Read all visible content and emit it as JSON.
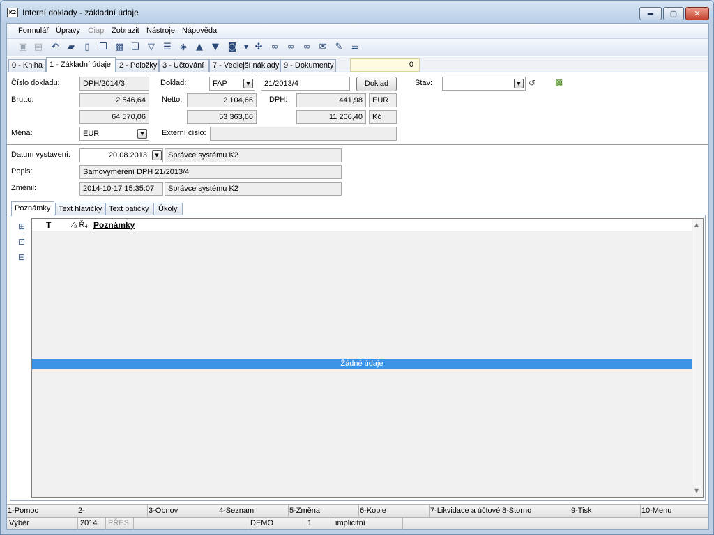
{
  "window": {
    "title": "Interní doklady - základní údaje",
    "icon_label": "K2",
    "min_label": "▬",
    "max_label": "▢",
    "close_label": "✕"
  },
  "menu": [
    {
      "label": "Formulář",
      "disabled": false
    },
    {
      "label": "Úpravy",
      "disabled": false
    },
    {
      "label": "Oiap",
      "disabled": true
    },
    {
      "label": "Zobrazit",
      "disabled": false
    },
    {
      "label": "Nástroje",
      "disabled": false
    },
    {
      "label": "Nápověda",
      "disabled": false
    }
  ],
  "toolbar": [
    {
      "name": "save-icon",
      "glyph": "▣",
      "gray": true
    },
    {
      "name": "save-as-icon",
      "glyph": "▤",
      "gray": true
    },
    {
      "name": "undo-icon",
      "glyph": "↶"
    },
    {
      "name": "open-folder-icon",
      "glyph": "▰"
    },
    {
      "name": "new-document-icon",
      "glyph": "▯"
    },
    {
      "name": "copy-icon",
      "glyph": "❐"
    },
    {
      "name": "lock-icon",
      "glyph": "▩"
    },
    {
      "name": "book-icon",
      "glyph": "❑"
    },
    {
      "name": "filter-icon",
      "glyph": "▽"
    },
    {
      "name": "filter-list-icon",
      "glyph": "☰"
    },
    {
      "name": "layers-icon",
      "glyph": "◈"
    },
    {
      "name": "arrow-up-icon",
      "glyph": "▲"
    },
    {
      "name": "arrow-down-icon",
      "glyph": "▼"
    },
    {
      "name": "camera-icon",
      "glyph": "◙"
    },
    {
      "name": "dropdown-arrow-icon",
      "glyph": "▾"
    },
    {
      "name": "plant-icon",
      "glyph": "✣"
    },
    {
      "name": "binoculars-icon",
      "glyph": "∞"
    },
    {
      "name": "binoculars-down-icon",
      "glyph": "∞"
    },
    {
      "name": "binoculars-up-icon",
      "glyph": "∞"
    },
    {
      "name": "mail-icon",
      "glyph": "✉"
    },
    {
      "name": "notepad-icon",
      "glyph": "✎"
    },
    {
      "name": "menu-lines-icon",
      "glyph": "≡"
    }
  ],
  "tabs": [
    {
      "label": "0 - Kniha",
      "active": false
    },
    {
      "label": "1 - Základní údaje",
      "active": true
    },
    {
      "label": "2 - Položky",
      "active": false
    },
    {
      "label": "3 - Účtování",
      "active": false
    },
    {
      "label": "7 - Vedlejší náklady",
      "active": false
    },
    {
      "label": "9 - Dokumenty",
      "active": false
    }
  ],
  "counter": "0",
  "form": {
    "cislo_label": "Číslo dokladu:",
    "cislo_value": "DPH/2014/3",
    "doklad_label": "Doklad:",
    "doklad_type": "FAP",
    "doklad_number": "21/2013/4",
    "doklad_button": "Doklad",
    "stav_label": "Stav:",
    "stav_value": "",
    "brutto_label": "Brutto:",
    "brutto_eur": "2 546,64",
    "brutto_czk": "64 570,06",
    "netto_label": "Netto:",
    "netto_eur": "2 104,66",
    "netto_czk": "53 363,66",
    "dph_label": "DPH:",
    "dph_eur": "441,98",
    "dph_czk": "11 206,40",
    "currency_1": "EUR",
    "currency_2": "Kč",
    "mena_label": "Měna:",
    "mena_value": "EUR",
    "externi_label": "Externí číslo:",
    "externi_value": "",
    "datum_label": "Datum vystavení:",
    "datum_value": "20.08.2013",
    "datum_user": "Správce systému K2",
    "popis_label": "Popis:",
    "popis_value": "Samovyměření DPH 21/2013/4",
    "zmenil_label": "Změnil:",
    "zmenil_date": "2014-10-17 15:35:07",
    "zmenil_user": "Správce systému K2"
  },
  "subtabs": [
    {
      "label": "Poznámky",
      "active": true
    },
    {
      "label": "Text hlavičky",
      "active": false
    },
    {
      "label": "Text patičky",
      "active": false
    },
    {
      "label": "Úkoly",
      "active": false
    }
  ],
  "grid": {
    "col_t": "T",
    "col_sort": "⁄₃ Ř₄",
    "col_notes": "Poznámky",
    "empty_text": "Žádné údaje"
  },
  "fkeys": [
    "1-Pomoc",
    "2-",
    "3-Obnov",
    "4-Seznam",
    "5-Změna",
    "6-Kopie",
    "7-Likvidace a účtové",
    "8-Storno",
    "9-Tisk",
    "10-Menu"
  ],
  "status": [
    {
      "text": "Výběr",
      "gray": false
    },
    {
      "text": "2014",
      "gray": false
    },
    {
      "text": "PŘES",
      "gray": true
    },
    {
      "text": "",
      "gray": false
    },
    {
      "text": "DEMO",
      "gray": false
    },
    {
      "text": "1",
      "gray": false
    },
    {
      "text": "implicitní",
      "gray": false
    }
  ]
}
